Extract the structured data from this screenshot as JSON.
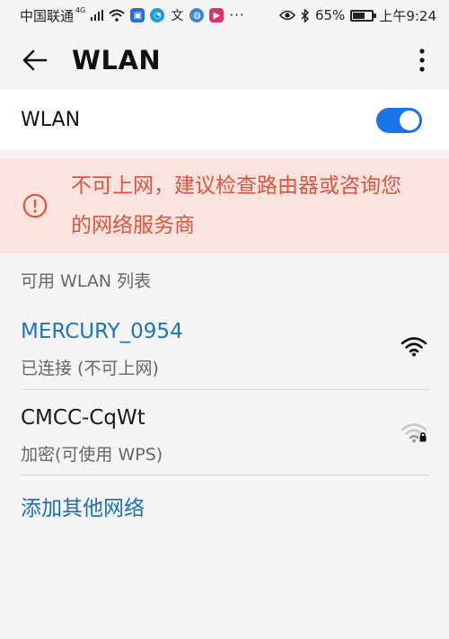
{
  "status_bar": {
    "carrier": "中国联通",
    "network_tag": "4G",
    "battery": "65%",
    "battery_level": 0.65,
    "time": "上午9:24",
    "more_apps": "···"
  },
  "app_bar": {
    "title": "WLAN"
  },
  "wlan_switch": {
    "label": "WLAN",
    "enabled": true
  },
  "warning": {
    "text": "不可上网，建议检查路由器或咨询您的网络服务商"
  },
  "list": {
    "header": "可用 WLAN 列表",
    "networks": [
      {
        "name": "MERCURY_0954",
        "status": "已连接 (不可上网)",
        "signal_icon": "wifi-full-icon"
      },
      {
        "name": "CMCC-CqWt",
        "status": "加密(可使用 WPS)",
        "signal_icon": "wifi-locked-weak-icon"
      }
    ],
    "add_other": "添加其他网络"
  },
  "colors": {
    "accent": "#1a73e8",
    "connected_text": "#1a73c7",
    "warning_bg": "#fbe4df",
    "warning_text": "#e0533f"
  }
}
